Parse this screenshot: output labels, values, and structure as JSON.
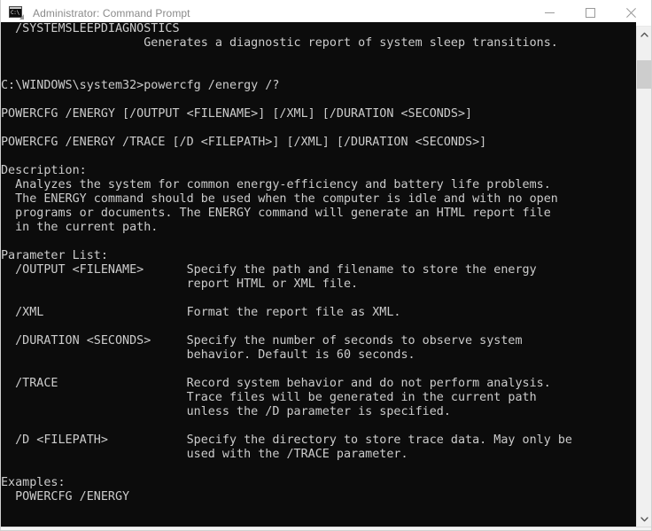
{
  "window": {
    "title": "Administrator: Command Prompt",
    "icon": "command-prompt-icon",
    "icon_glyph": "C:\\",
    "controls": {
      "minimize_label": "Minimize",
      "maximize_label": "Maximize",
      "close_label": "Close"
    },
    "colors": {
      "titlebar_bg": "#ffffff",
      "title_text": "#8a8a8a",
      "console_bg": "#0c0c0c",
      "console_text": "#cccccc",
      "scrollbar_track": "#f0f0f0",
      "scrollbar_thumb": "#cdcdcd"
    }
  },
  "scrollbar": {
    "up_arrow": "chevron-up-icon",
    "down_arrow": "chevron-down-icon",
    "thumb_position_percent": 4,
    "thumb_size_percent": 6
  },
  "console": {
    "prompt_path": "C:\\WINDOWS\\system32",
    "command": "powercfg /energy /?",
    "lines": [
      "  /SYSTEMSLEEPDIAGNOSTICS",
      "                    Generates a diagnostic report of system sleep transitions.",
      "",
      "",
      "C:\\WINDOWS\\system32>powercfg /energy /?",
      "",
      "POWERCFG /ENERGY [/OUTPUT <FILENAME>] [/XML] [/DURATION <SECONDS>]",
      "",
      "POWERCFG /ENERGY /TRACE [/D <FILEPATH>] [/XML] [/DURATION <SECONDS>]",
      "",
      "Description:",
      "  Analyzes the system for common energy-efficiency and battery life problems.",
      "  The ENERGY command should be used when the computer is idle and with no open",
      "  programs or documents. The ENERGY command will generate an HTML report file",
      "  in the current path.",
      "",
      "Parameter List:",
      "  /OUTPUT <FILENAME>      Specify the path and filename to store the energy",
      "                          report HTML or XML file.",
      "",
      "  /XML                    Format the report file as XML.",
      "",
      "  /DURATION <SECONDS>     Specify the number of seconds to observe system",
      "                          behavior. Default is 60 seconds.",
      "",
      "  /TRACE                  Record system behavior and do not perform analysis.",
      "                          Trace files will be generated in the current path",
      "                          unless the /D parameter is specified.",
      "",
      "  /D <FILEPATH>           Specify the directory to store trace data. May only be",
      "                          used with the /TRACE parameter.",
      "",
      "Examples:",
      "  POWERCFG /ENERGY"
    ]
  }
}
